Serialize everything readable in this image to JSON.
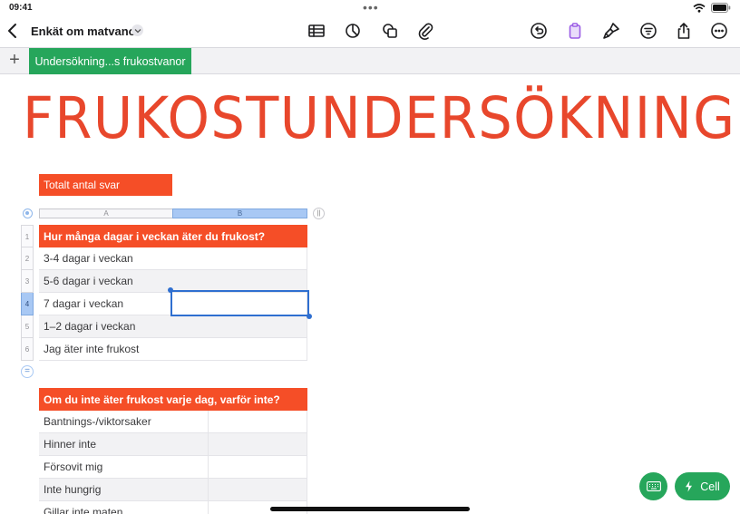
{
  "status": {
    "time": "09:41"
  },
  "toolbar": {
    "doc_title": "Enkät om matvanor"
  },
  "tabs": {
    "active_label": "Undersökning...s frukostvanor",
    "add_label": "+"
  },
  "page": {
    "heading": "FRUKOSTUNDERSÖKNING",
    "badge": "Totalt antal svar"
  },
  "table1": {
    "col_a": "A",
    "col_b": "B",
    "row_numbers": [
      "1",
      "2",
      "3",
      "4",
      "5",
      "6"
    ],
    "header": "Hur många dagar i veckan äter du frukost?",
    "rows": [
      "3-4 dagar i veckan",
      "5-6 dagar i veckan",
      "7 dagar i veckan",
      "1–2 dagar i veckan",
      "Jag äter inte frukost"
    ]
  },
  "table2": {
    "header": "Om du inte äter frukost varje dag, varför inte?",
    "rows": [
      "Bantnings-/viktorsaker",
      "Hinner inte",
      "Försovit mig",
      "Inte hungrig",
      "Gillar inte maten"
    ]
  },
  "actions": {
    "cell_label": "Cell"
  },
  "colors": {
    "accent_red": "#f54e27",
    "title_red": "#e8472c",
    "accent_green": "#26a65b",
    "selection_blue": "#2f6fd0"
  }
}
